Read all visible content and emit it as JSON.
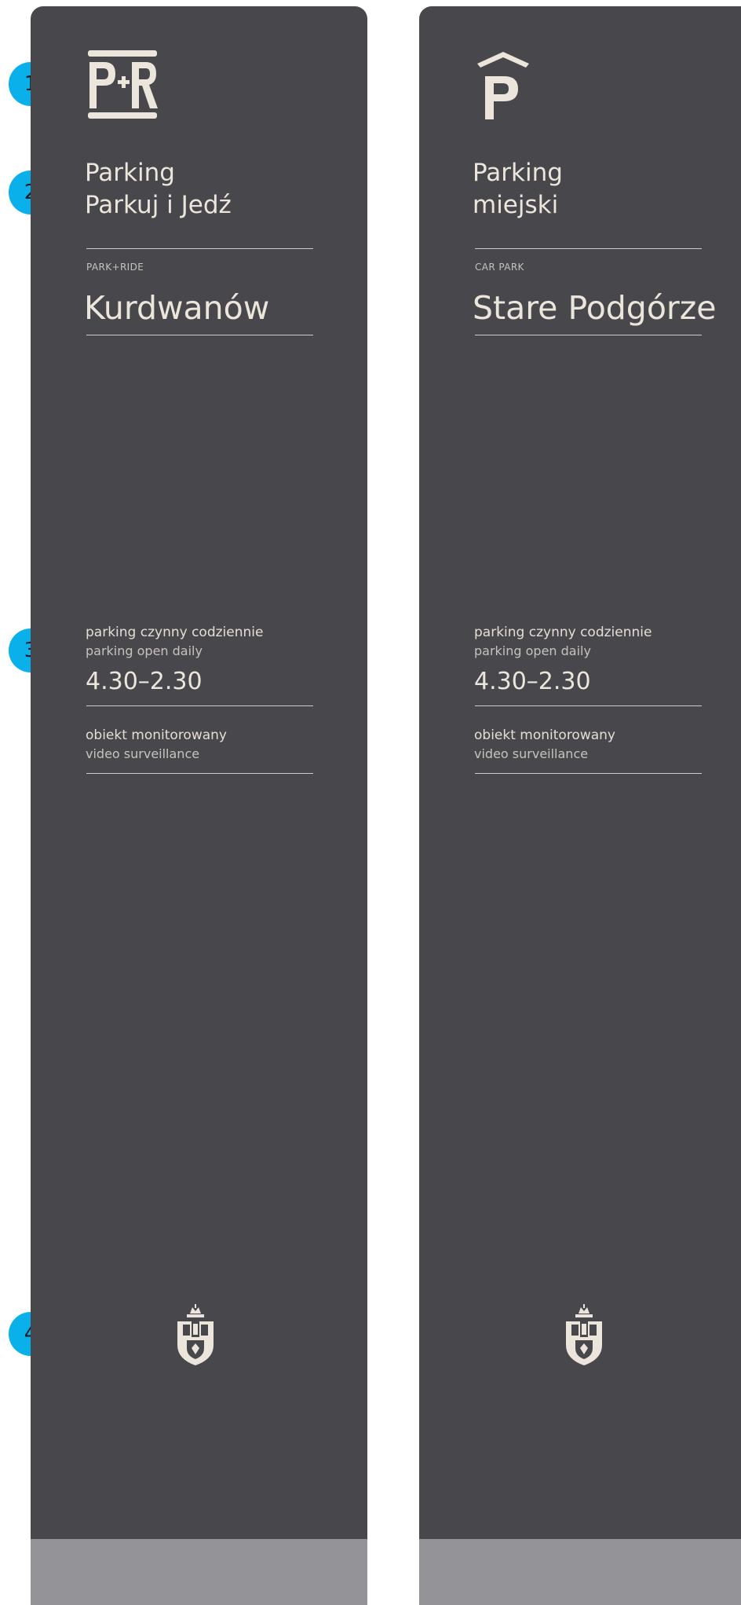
{
  "markers": [
    "1",
    "2",
    "3",
    "4"
  ],
  "signs": [
    {
      "logo": "pr-logo",
      "name_line1": "Parking",
      "name_line2": "Parkuj i Jedź",
      "kicker": "PARK+RIDE",
      "place": "Kurdwanów",
      "hours_pl": "parking czynny codziennie",
      "hours_en": "parking open daily",
      "hours": "4.30–2.30",
      "monitor_pl": "obiekt monitorowany",
      "monitor_en": "video surveillance",
      "crest": "krakow-coat-of-arms-icon"
    },
    {
      "logo": "p-roof-logo",
      "name_line1": "Parking",
      "name_line2": "miejski",
      "kicker": "CAR PARK",
      "place": "Stare Podgórze",
      "hours_pl": "parking czynny codziennie",
      "hours_en": "parking open daily",
      "hours": "4.30–2.30",
      "monitor_pl": "obiekt monitorowany",
      "monitor_en": "video surveillance",
      "crest": "krakow-coat-of-arms-icon"
    }
  ],
  "colors": {
    "panel": "#48484c",
    "base": "#939398",
    "text": "#ebe5dc",
    "marker": "#0ab0ea"
  }
}
